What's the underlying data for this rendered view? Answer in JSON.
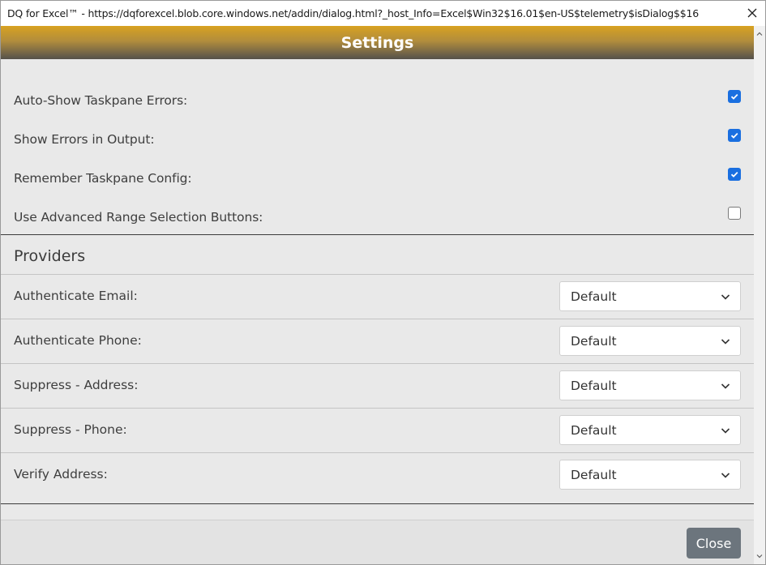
{
  "window": {
    "title": "DQ for Excel™ - https://dqforexcel.blob.core.windows.net/addin/dialog.html?_host_Info=Excel$Win32$16.01$en-US$telemetry$isDialog$$16"
  },
  "header": {
    "title": "Settings"
  },
  "preferences": [
    {
      "label": "Auto-Show Taskpane Errors:",
      "checked": true
    },
    {
      "label": "Show Errors in Output:",
      "checked": true
    },
    {
      "label": "Remember Taskpane Config:",
      "checked": true
    },
    {
      "label": "Use Advanced Range Selection Buttons:",
      "checked": false
    }
  ],
  "providers": {
    "title": "Providers",
    "items": [
      {
        "label": "Authenticate Email:",
        "value": "Default"
      },
      {
        "label": "Authenticate Phone:",
        "value": "Default"
      },
      {
        "label": "Suppress - Address:",
        "value": "Default"
      },
      {
        "label": "Suppress - Phone:",
        "value": "Default"
      },
      {
        "label": "Verify Address:",
        "value": "Default"
      }
    ]
  },
  "footer": {
    "close_label": "Close"
  },
  "colors": {
    "accent": "#1a6fe0",
    "banner": "#b28d3c",
    "close_button": "#6c757d"
  },
  "icons": {
    "window_close": "close-icon",
    "check": "checkmark-icon",
    "dropdown": "chevron-down-icon"
  }
}
